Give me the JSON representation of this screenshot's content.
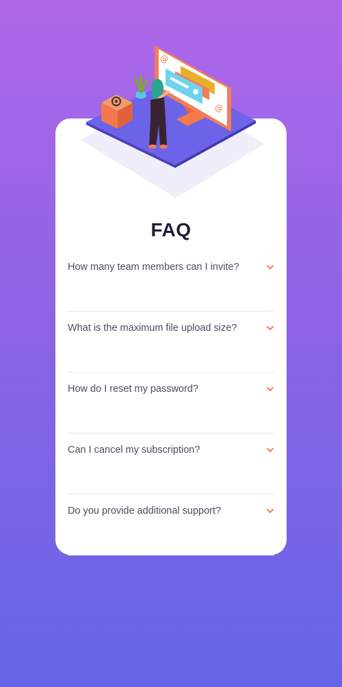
{
  "title": "FAQ",
  "faq": [
    {
      "question": "How many team members can I invite?"
    },
    {
      "question": "What is the maximum file upload size?"
    },
    {
      "question": "How do I reset my password?"
    },
    {
      "question": "Can I cancel my subscription?"
    },
    {
      "question": "Do you provide additional support?"
    }
  ],
  "icons": {
    "expand": "chevron-down-icon"
  },
  "colors": {
    "accent": "#f47c57",
    "heading": "#1e1f36",
    "text": "#4b4c5f",
    "background_top": "#af67e9",
    "background_bottom": "#6565e7"
  }
}
